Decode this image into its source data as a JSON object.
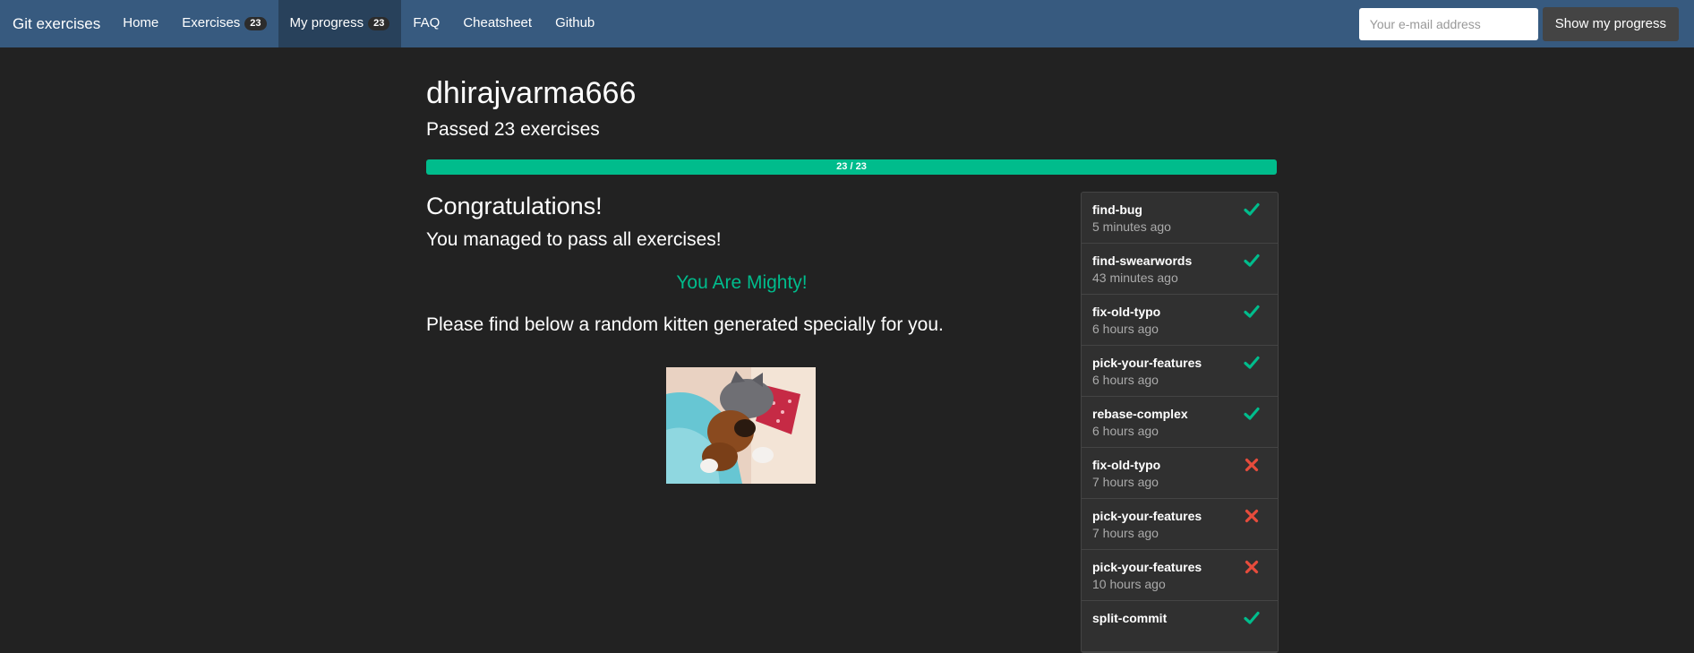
{
  "nav": {
    "brand": "Git exercises",
    "items": [
      {
        "label": "Home"
      },
      {
        "label": "Exercises",
        "badge": "23"
      },
      {
        "label": "My progress",
        "badge": "23",
        "active": true
      },
      {
        "label": "FAQ"
      },
      {
        "label": "Cheatsheet"
      },
      {
        "label": "Github"
      }
    ],
    "email_placeholder": "Your e-mail address",
    "show_button": "Show my progress"
  },
  "profile": {
    "username": "dhirajvarma666",
    "passed_text": "Passed 23 exercises",
    "progress_label": "23 / 23",
    "progress_fraction": 1.0
  },
  "content": {
    "congrats": "Congratulations!",
    "managed": "You managed to pass all exercises!",
    "mighty": "You Are Mighty!",
    "kitten_text": "Please find below a random kitten generated specially for you."
  },
  "attempts": [
    {
      "name": "find-bug",
      "time": "5 minutes ago",
      "status": "pass"
    },
    {
      "name": "find-swearwords",
      "time": "43 minutes ago",
      "status": "pass"
    },
    {
      "name": "fix-old-typo",
      "time": "6 hours ago",
      "status": "pass"
    },
    {
      "name": "pick-your-features",
      "time": "6 hours ago",
      "status": "pass"
    },
    {
      "name": "rebase-complex",
      "time": "6 hours ago",
      "status": "pass"
    },
    {
      "name": "fix-old-typo",
      "time": "7 hours ago",
      "status": "fail"
    },
    {
      "name": "pick-your-features",
      "time": "7 hours ago",
      "status": "fail"
    },
    {
      "name": "pick-your-features",
      "time": "10 hours ago",
      "status": "fail"
    },
    {
      "name": "split-commit",
      "time": "",
      "status": "pass"
    }
  ],
  "colors": {
    "nav": "#375a7f",
    "success": "#00bc8c",
    "danger": "#e74c3c",
    "bg": "#222222"
  }
}
